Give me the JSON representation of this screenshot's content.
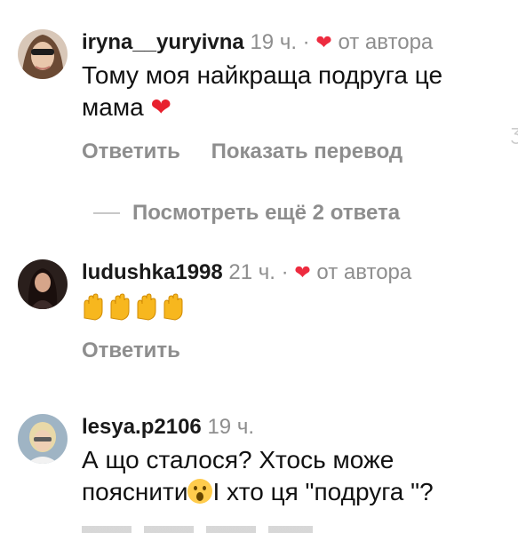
{
  "comments": [
    {
      "username": "iryna__yuryivna",
      "time": "19 ч.",
      "dot": "·",
      "author_label": "от автора",
      "text_line1": "Тому моя найкраща подруга це",
      "text_line2": "мама",
      "reply_label": "Ответить",
      "translate_label": "Показать перевод"
    },
    {
      "username": "ludushka1998",
      "time": "21 ч.",
      "dot": "·",
      "author_label": "от автора",
      "reply_label": "Ответить"
    },
    {
      "username": "lesya.p2106",
      "time": "19 ч.",
      "text_line1": "А що сталося? Хтось може",
      "text_line2a": "пояснити",
      "text_line2b": "І хто ця \"подруга \"?"
    }
  ],
  "more_replies_label": "Посмотреть ещё 2 ответа",
  "colors": {
    "meta_gray": "#8e8e8e",
    "heart_red": "#ed2b3f"
  }
}
